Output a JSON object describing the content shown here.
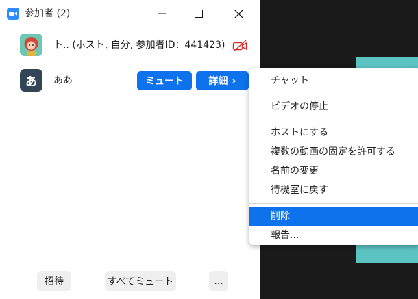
{
  "window": {
    "title": "参加者 (2)"
  },
  "participants": [
    {
      "name": "ト.. (ホスト, 自分, 参加者ID：441423)",
      "camera": "video-off"
    },
    {
      "avatar_letter": "あ",
      "name": "ああ",
      "mute_label": "ミュート",
      "detail_label": "詳細",
      "detail_chevron": "›"
    }
  ],
  "context_menu": {
    "items": [
      "チャット",
      "ビデオの停止",
      "ホストにする",
      "複数の動画の固定を許可する",
      "名前の変更",
      "待機室に戻す",
      "削除",
      "報告..."
    ],
    "selected": "削除"
  },
  "footer": {
    "invite_label": "招待",
    "mute_all_label": "すべてミュート",
    "more_label": "..."
  },
  "colors": {
    "accent": "#0e72ed",
    "teal": "#5cc3c3",
    "avatar_dark": "#324658",
    "camera_off": "#e02828"
  }
}
